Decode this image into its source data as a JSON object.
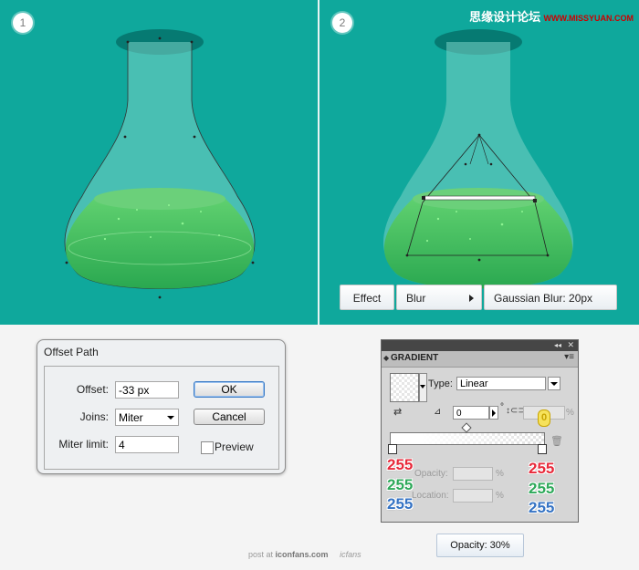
{
  "panel1": {
    "step": "1"
  },
  "panel2": {
    "step": "2"
  },
  "watermark": {
    "cn": "思缘设计论坛",
    "en": "WWW.MISSYUAN.COM"
  },
  "effect_bar": {
    "effect": "Effect",
    "blur": "Blur",
    "gaussian": "Gaussian Blur: 20px"
  },
  "offset_dialog": {
    "title": "Offset Path",
    "offset_label": "Offset:",
    "offset_value": "-33 px",
    "joins_label": "Joins:",
    "joins_value": "Miter",
    "miter_label": "Miter limit:",
    "miter_value": "4",
    "ok": "OK",
    "cancel": "Cancel",
    "preview": "Preview"
  },
  "gradient_panel": {
    "tab": "GRADIENT",
    "type_label": "Type:",
    "type_value": "Linear",
    "angle_value": "0",
    "degree": "°",
    "aspect_badge": "0",
    "percent": "%",
    "opacity_label": "Opacity:",
    "location_label": "Location:",
    "left_stop": {
      "r": "255",
      "g": "255",
      "b": "255"
    },
    "right_stop": {
      "r": "255",
      "g": "255",
      "b": "255"
    }
  },
  "opacity_note": "Opacity: 30%",
  "footer": {
    "prefix": "post at",
    "site": "iconfans.com",
    "logo": "icfans"
  },
  "colors": {
    "teal": "#0fa89c",
    "liquid": "#3fc260"
  }
}
